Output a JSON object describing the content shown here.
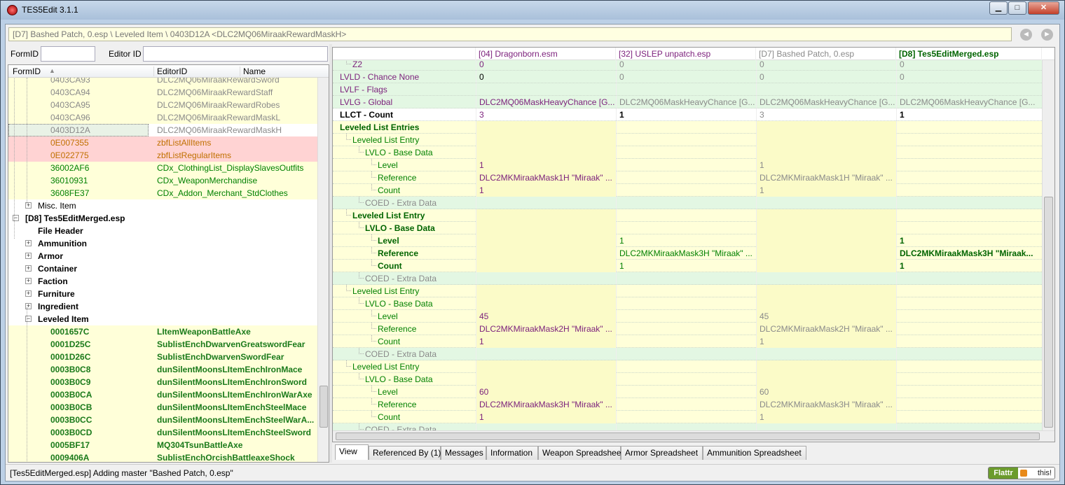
{
  "window": {
    "title": "TES5Edit 3.1.1",
    "minimize": "▁",
    "maximize": "□",
    "close": "✕"
  },
  "path": {
    "text": "[D7] Bashed Patch, 0.esp \\ Leveled Item \\ 0403D12A <DLC2MQ06MiraakRewardMaskH>",
    "back": "◄",
    "forward": "►"
  },
  "filter": {
    "formid_label": "FormID",
    "editorid_label": "Editor ID",
    "formid_value": "",
    "editorid_value": ""
  },
  "tree": {
    "headers": [
      "FormID",
      "EditorID",
      "Name"
    ],
    "sort_icon": "▲",
    "rows": [
      {
        "id": "0403CA93",
        "edid": "DLC2MQ06MiraakRewardSword",
        "indent": 2,
        "style": "y"
      },
      {
        "id": "0403CA94",
        "edid": "DLC2MQ06MiraakRewardStaff",
        "indent": 2,
        "style": "y"
      },
      {
        "id": "0403CA95",
        "edid": "DLC2MQ06MiraakRewardRobes",
        "indent": 2,
        "style": "y"
      },
      {
        "id": "0403CA96",
        "edid": "DLC2MQ06MiraakRewardMaskL",
        "indent": 2,
        "style": "y"
      },
      {
        "id": "0403D12A",
        "edid": "DLC2MQ06MiraakRewardMaskH",
        "indent": 2,
        "style": "sel"
      },
      {
        "id": "0E007355",
        "edid": "zbfListAllItems",
        "indent": 2,
        "style": "red"
      },
      {
        "id": "0E022775",
        "edid": "zbfListRegularItems",
        "indent": 2,
        "style": "red"
      },
      {
        "id": "36002AF6",
        "edid": "CDx_ClothingList_DisplaySlavesOutfits",
        "indent": 2,
        "style": "yg"
      },
      {
        "id": "36010931",
        "edid": "CDx_WeaponMerchandise",
        "indent": 2,
        "style": "yg"
      },
      {
        "id": "3608FE37",
        "edid": "CDx_Addon_Merchant_StdClothes",
        "indent": 2,
        "style": "yg"
      },
      {
        "id": "Misc. Item",
        "edid": "",
        "indent": 1,
        "style": "group",
        "exp": "+"
      },
      {
        "id": "[D8] Tes5EditMerged.esp",
        "edid": "",
        "indent": 0,
        "style": "bold",
        "exp": "−"
      },
      {
        "id": "File Header",
        "edid": "",
        "indent": 1,
        "style": "bold"
      },
      {
        "id": "Ammunition",
        "edid": "",
        "indent": 1,
        "style": "bold",
        "exp": "+"
      },
      {
        "id": "Armor",
        "edid": "",
        "indent": 1,
        "style": "bold",
        "exp": "+"
      },
      {
        "id": "Container",
        "edid": "",
        "indent": 1,
        "style": "bold",
        "exp": "+"
      },
      {
        "id": "Faction",
        "edid": "",
        "indent": 1,
        "style": "bold",
        "exp": "+"
      },
      {
        "id": "Furniture",
        "edid": "",
        "indent": 1,
        "style": "bold",
        "exp": "+"
      },
      {
        "id": "Ingredient",
        "edid": "",
        "indent": 1,
        "style": "bold",
        "exp": "+"
      },
      {
        "id": "Leveled Item",
        "edid": "",
        "indent": 1,
        "style": "bold",
        "exp": "−"
      },
      {
        "id": "0001657C",
        "edid": "LItemWeaponBattleAxe",
        "indent": 2,
        "style": "yb"
      },
      {
        "id": "0001D25C",
        "edid": "SublistEnchDwarvenGreatswordFear",
        "indent": 2,
        "style": "yb"
      },
      {
        "id": "0001D26C",
        "edid": "SublistEnchDwarvenSwordFear",
        "indent": 2,
        "style": "yb"
      },
      {
        "id": "0003B0C8",
        "edid": "dunSilentMoonsLItemEnchIronMace",
        "indent": 2,
        "style": "yb"
      },
      {
        "id": "0003B0C9",
        "edid": "dunSilentMoonsLItemEnchIronSword",
        "indent": 2,
        "style": "yb"
      },
      {
        "id": "0003B0CA",
        "edid": "dunSilentMoonsLItemEnchIronWarAxe",
        "indent": 2,
        "style": "yb"
      },
      {
        "id": "0003B0CB",
        "edid": "dunSilentMoonsLItemEnchSteelMace",
        "indent": 2,
        "style": "yb"
      },
      {
        "id": "0003B0CC",
        "edid": "dunSilentMoonsLItemEnchSteelWarA...",
        "indent": 2,
        "style": "yb"
      },
      {
        "id": "0003B0CD",
        "edid": "dunSilentMoonsLItemEnchSteelSword",
        "indent": 2,
        "style": "yb"
      },
      {
        "id": "0005BF17",
        "edid": "MQ304TsunBattleAxe",
        "indent": 2,
        "style": "yb"
      },
      {
        "id": "0009406A",
        "edid": "SublistEnchOrcishBattleaxeShock",
        "indent": 2,
        "style": "yb"
      }
    ]
  },
  "grid": {
    "headers": [
      "",
      "[04] Dragonborn.esm",
      "[32] USLEP unpatch.esp",
      "[D7] Bashed Patch, 0.esp",
      "[D8] Tes5EditMerged.esp"
    ],
    "rows": [
      {
        "name": "Z2",
        "indent": 1,
        "bg": "g",
        "nstyle": "pg",
        "v": [
          "0",
          "0",
          "0",
          "0"
        ],
        "vs": [
          "p",
          "gr",
          "gr",
          "gr"
        ]
      },
      {
        "name": "LVLD - Chance None",
        "indent": 0,
        "bg": "g",
        "nstyle": "pu",
        "v": [
          "0",
          "0",
          "0",
          "0"
        ],
        "vs": [
          "k",
          "gr",
          "gr",
          "gr"
        ]
      },
      {
        "name": "LVLF - Flags",
        "indent": 0,
        "bg": "g",
        "nstyle": "pu",
        "v": [
          "",
          "",
          "",
          ""
        ],
        "vs": [
          "k",
          "k",
          "k",
          "k"
        ]
      },
      {
        "name": "LVLG - Global",
        "indent": 0,
        "bg": "g",
        "nstyle": "pu",
        "v": [
          "DLC2MQ06MaskHeavyChance [G...",
          "DLC2MQ06MaskHeavyChance [G...",
          "DLC2MQ06MaskHeavyChance [G...",
          "DLC2MQ06MaskHeavyChance [G..."
        ],
        "vs": [
          "pu",
          "gr",
          "gr",
          "gr"
        ]
      },
      {
        "name": "LLCT - Count",
        "indent": 0,
        "bg": "w",
        "nstyle": "bk",
        "v": [
          "3",
          "1",
          "3",
          "1"
        ],
        "vs": [
          "pu",
          "bk",
          "gr",
          "bk"
        ]
      },
      {
        "name": "Leveled List Entries",
        "indent": 0,
        "bg": "y",
        "nstyle": "bg",
        "v": [
          "",
          "",
          "",
          ""
        ],
        "vs": [
          "k",
          "k",
          "k",
          "k"
        ]
      },
      {
        "name": "Leveled List Entry",
        "indent": 1,
        "bg": "y",
        "nstyle": "gn",
        "v": [
          "",
          "",
          "",
          ""
        ],
        "vs": [
          "k",
          "k",
          "k",
          "k"
        ]
      },
      {
        "name": "LVLO - Base Data",
        "indent": 2,
        "bg": "y",
        "nstyle": "gn",
        "v": [
          "",
          "",
          "",
          ""
        ],
        "vs": [
          "k",
          "k",
          "k",
          "k"
        ]
      },
      {
        "name": "Level",
        "indent": 3,
        "bg": "y",
        "nstyle": "gn",
        "v": [
          "1",
          "",
          "1",
          ""
        ],
        "vs": [
          "pu",
          "k",
          "gr",
          "k"
        ]
      },
      {
        "name": "Reference",
        "indent": 3,
        "bg": "y",
        "nstyle": "gn",
        "v": [
          "DLC2MKMiraakMask1H \"Miraak\" ...",
          "",
          "DLC2MKMiraakMask1H \"Miraak\" ...",
          ""
        ],
        "vs": [
          "pu",
          "k",
          "gr",
          "k"
        ]
      },
      {
        "name": "Count",
        "indent": 3,
        "bg": "y",
        "nstyle": "gn",
        "v": [
          "1",
          "",
          "1",
          ""
        ],
        "vs": [
          "pu",
          "k",
          "gr",
          "k"
        ]
      },
      {
        "name": "COED - Extra Data",
        "indent": 2,
        "bg": "g",
        "nstyle": "gr",
        "v": [
          "",
          "",
          "",
          ""
        ],
        "vs": [
          "k",
          "k",
          "k",
          "k"
        ]
      },
      {
        "name": "Leveled List Entry",
        "indent": 1,
        "bg": "y",
        "nstyle": "bg",
        "v": [
          "",
          "",
          "",
          ""
        ],
        "vs": [
          "k",
          "k",
          "k",
          "k"
        ]
      },
      {
        "name": "LVLO - Base Data",
        "indent": 2,
        "bg": "y",
        "nstyle": "bg",
        "v": [
          "",
          "",
          "",
          ""
        ],
        "vs": [
          "k",
          "k",
          "k",
          "k"
        ]
      },
      {
        "name": "Level",
        "indent": 3,
        "bg": "y",
        "nstyle": "bg",
        "v": [
          "",
          "1",
          "",
          "1"
        ],
        "vs": [
          "k",
          "g",
          "k",
          "bg"
        ]
      },
      {
        "name": "Reference",
        "indent": 3,
        "bg": "y",
        "nstyle": "bg",
        "v": [
          "",
          "DLC2MKMiraakMask3H \"Miraak\" ...",
          "",
          "DLC2MKMiraakMask3H \"Miraak..."
        ],
        "vs": [
          "k",
          "g",
          "k",
          "bg"
        ]
      },
      {
        "name": "Count",
        "indent": 3,
        "bg": "y",
        "nstyle": "bg",
        "v": [
          "",
          "1",
          "",
          "1"
        ],
        "vs": [
          "k",
          "g",
          "k",
          "bg"
        ]
      },
      {
        "name": "COED - Extra Data",
        "indent": 2,
        "bg": "g",
        "nstyle": "gr",
        "v": [
          "",
          "",
          "",
          ""
        ],
        "vs": [
          "k",
          "k",
          "k",
          "k"
        ]
      },
      {
        "name": "Leveled List Entry",
        "indent": 1,
        "bg": "y",
        "nstyle": "gn",
        "v": [
          "",
          "",
          "",
          ""
        ],
        "vs": [
          "k",
          "k",
          "k",
          "k"
        ]
      },
      {
        "name": "LVLO - Base Data",
        "indent": 2,
        "bg": "y",
        "nstyle": "gn",
        "v": [
          "",
          "",
          "",
          ""
        ],
        "vs": [
          "k",
          "k",
          "k",
          "k"
        ]
      },
      {
        "name": "Level",
        "indent": 3,
        "bg": "y",
        "nstyle": "gn",
        "v": [
          "45",
          "",
          "45",
          ""
        ],
        "vs": [
          "pu",
          "k",
          "gr",
          "k"
        ]
      },
      {
        "name": "Reference",
        "indent": 3,
        "bg": "y",
        "nstyle": "gn",
        "v": [
          "DLC2MKMiraakMask2H \"Miraak\" ...",
          "",
          "DLC2MKMiraakMask2H \"Miraak\" ...",
          ""
        ],
        "vs": [
          "pu",
          "k",
          "gr",
          "k"
        ]
      },
      {
        "name": "Count",
        "indent": 3,
        "bg": "y",
        "nstyle": "gn",
        "v": [
          "1",
          "",
          "1",
          ""
        ],
        "vs": [
          "pu",
          "k",
          "gr",
          "k"
        ]
      },
      {
        "name": "COED - Extra Data",
        "indent": 2,
        "bg": "g",
        "nstyle": "gr",
        "v": [
          "",
          "",
          "",
          ""
        ],
        "vs": [
          "k",
          "k",
          "k",
          "k"
        ]
      },
      {
        "name": "Leveled List Entry",
        "indent": 1,
        "bg": "y",
        "nstyle": "gn",
        "v": [
          "",
          "",
          "",
          ""
        ],
        "vs": [
          "k",
          "k",
          "k",
          "k"
        ]
      },
      {
        "name": "LVLO - Base Data",
        "indent": 2,
        "bg": "y",
        "nstyle": "gn",
        "v": [
          "",
          "",
          "",
          ""
        ],
        "vs": [
          "k",
          "k",
          "k",
          "k"
        ]
      },
      {
        "name": "Level",
        "indent": 3,
        "bg": "y",
        "nstyle": "gn",
        "v": [
          "60",
          "",
          "60",
          ""
        ],
        "vs": [
          "pu",
          "k",
          "gr",
          "k"
        ]
      },
      {
        "name": "Reference",
        "indent": 3,
        "bg": "y",
        "nstyle": "gn",
        "v": [
          "DLC2MKMiraakMask3H \"Miraak\" ...",
          "",
          "DLC2MKMiraakMask3H \"Miraak\" ...",
          ""
        ],
        "vs": [
          "pu",
          "k",
          "gr",
          "k"
        ]
      },
      {
        "name": "Count",
        "indent": 3,
        "bg": "y",
        "nstyle": "gn",
        "v": [
          "1",
          "",
          "1",
          ""
        ],
        "vs": [
          "pu",
          "k",
          "gr",
          "k"
        ]
      },
      {
        "name": "COED - Extra Data",
        "indent": 2,
        "bg": "g",
        "nstyle": "gr",
        "v": [
          "",
          "",
          "",
          ""
        ],
        "vs": [
          "k",
          "k",
          "k",
          "k"
        ]
      }
    ]
  },
  "tabs": [
    "View",
    "Referenced By (1)",
    "Messages",
    "Information",
    "Weapon Spreadsheet",
    "Armor Spreadsheet",
    "Ammunition Spreadsheet"
  ],
  "status": {
    "text": "[Tes5EditMerged.esp] Adding master \"Bashed Patch, 0.esp\"",
    "flattr_left": "Flattr",
    "flattr_right": "this!"
  },
  "colors": {
    "yellow": "#ffffd9",
    "green_row": "#e3f7e3",
    "selected": "#e9f2e6",
    "red_row": "#ffd3d3",
    "purple": "#7b1f7b",
    "green_text": "#008000",
    "bold_green": "#006400",
    "gray": "#8a8a8a",
    "dark_green": "#1a7a1a"
  }
}
